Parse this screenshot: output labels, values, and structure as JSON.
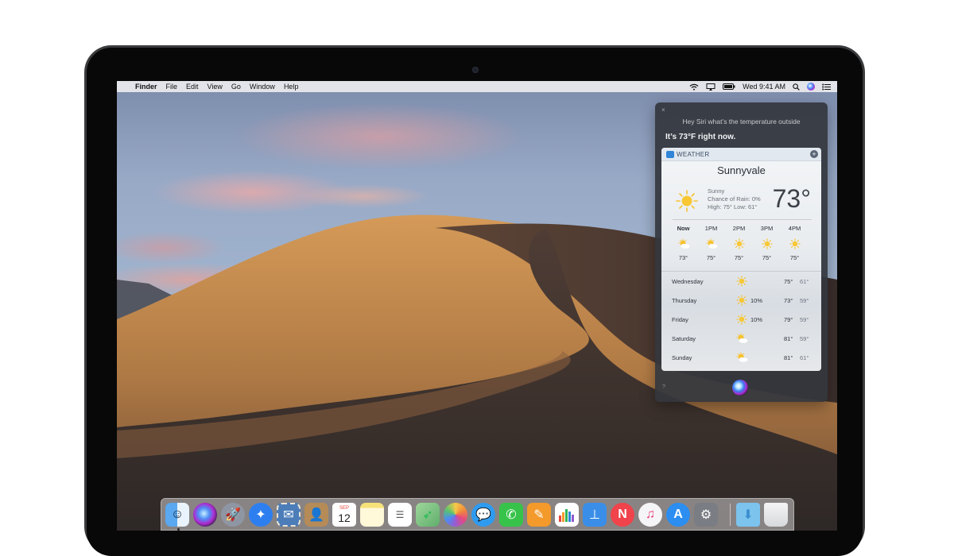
{
  "menubar": {
    "app_name": "Finder",
    "menus": [
      "File",
      "Edit",
      "View",
      "Go",
      "Window",
      "Help"
    ],
    "clock": "Wed 9:41 AM"
  },
  "siri": {
    "close_label": "×",
    "query": "Hey Siri what’s the temperature outside",
    "response": "It’s 73°F right now.",
    "help_label": "?",
    "card": {
      "tag": "WEATHER",
      "plus_label": "+",
      "city": "Sunnyvale",
      "condition": "Sunny",
      "rain": "Chance of Rain: 0%",
      "hilo": "High: 75° Low: 61°",
      "temperature": "73°",
      "hourly": [
        {
          "label": "Now",
          "icon": "sun-cloud-icon",
          "temp": "73°"
        },
        {
          "label": "1PM",
          "icon": "sun-cloud-icon",
          "temp": "75°"
        },
        {
          "label": "2PM",
          "icon": "sun-icon",
          "temp": "75°"
        },
        {
          "label": "3PM",
          "icon": "sun-icon",
          "temp": "75°"
        },
        {
          "label": "4PM",
          "icon": "sun-icon",
          "temp": "75°"
        }
      ],
      "daily": [
        {
          "day": "Wednesday",
          "icon": "sun-icon",
          "precip": "",
          "high": "75°",
          "low": "61°"
        },
        {
          "day": "Thursday",
          "icon": "sun-icon",
          "precip": "10%",
          "high": "73°",
          "low": "59°"
        },
        {
          "day": "Friday",
          "icon": "sun-icon",
          "precip": "10%",
          "high": "79°",
          "low": "59°"
        },
        {
          "day": "Saturday",
          "icon": "sun-cloud-icon",
          "precip": "",
          "high": "81°",
          "low": "59°"
        },
        {
          "day": "Sunday",
          "icon": "sun-cloud-icon",
          "precip": "",
          "high": "81°",
          "low": "61°"
        }
      ]
    }
  },
  "dock": {
    "calendar_month": "SEP",
    "calendar_day": "12",
    "apps": [
      {
        "name": "finder",
        "icon": "finder-icon",
        "color": "#3f8de6"
      },
      {
        "name": "siri",
        "icon": "siri-icon",
        "color": "#2a2f4a"
      },
      {
        "name": "launchpad",
        "icon": "rocket-icon",
        "color": "#8f96a3"
      },
      {
        "name": "safari",
        "icon": "compass-icon",
        "color": "#2d7ff0"
      },
      {
        "name": "mail",
        "icon": "stamp-icon",
        "color": "#4c7db8"
      },
      {
        "name": "contacts",
        "icon": "contacts-icon",
        "color": "#b58b57"
      },
      {
        "name": "calendar",
        "icon": "calendar-icon",
        "color": "#ffffff"
      },
      {
        "name": "notes",
        "icon": "notes-icon",
        "color": "#f7e27a"
      },
      {
        "name": "reminders",
        "icon": "reminders-icon",
        "color": "#ffffff"
      },
      {
        "name": "maps",
        "icon": "map-icon",
        "color": "#6cbf72"
      },
      {
        "name": "photos",
        "icon": "photos-icon",
        "color": "#ffffff"
      },
      {
        "name": "messages",
        "icon": "messages-icon",
        "color": "#2f9bf0"
      },
      {
        "name": "facetime",
        "icon": "video-camera-icon",
        "color": "#37c34a"
      },
      {
        "name": "pages",
        "icon": "pages-icon",
        "color": "#f39a2b"
      },
      {
        "name": "numbers",
        "icon": "bar-chart-icon",
        "color": "#2fb35a"
      },
      {
        "name": "keynote",
        "icon": "keynote-icon",
        "color": "#3a8ee8"
      },
      {
        "name": "news",
        "icon": "news-icon",
        "color": "#f0434b"
      },
      {
        "name": "itunes",
        "icon": "music-note-icon",
        "color": "#f5f5f7"
      },
      {
        "name": "app-store",
        "icon": "app-store-icon",
        "color": "#2b8ef0"
      },
      {
        "name": "system-preferences",
        "icon": "gear-icon",
        "color": "#7a7d83"
      },
      {
        "name": "downloads",
        "icon": "folder-icon",
        "color": "#7cc3ee"
      },
      {
        "name": "trash",
        "icon": "trash-icon",
        "color": "#e9eaec"
      }
    ]
  }
}
